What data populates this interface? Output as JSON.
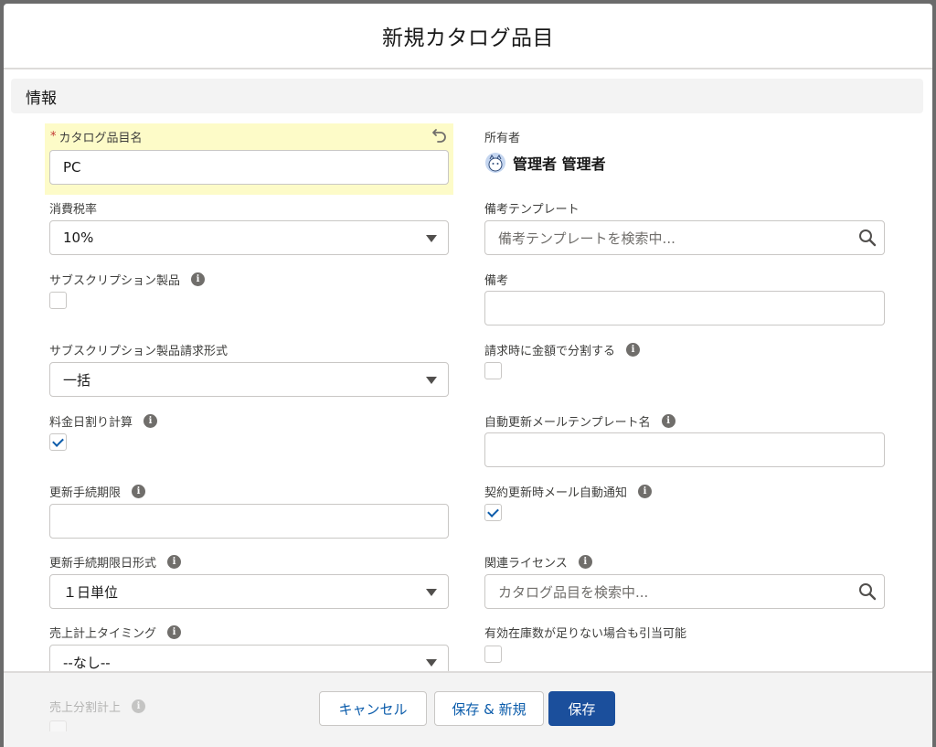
{
  "modal": {
    "title": "新規カタログ品目"
  },
  "section": {
    "title": "情報"
  },
  "fields": {
    "catalog_name": {
      "label": "カタログ品目名",
      "required_mark": "*",
      "value": "PC"
    },
    "owner": {
      "label": "所有者",
      "value": "管理者 管理者"
    },
    "tax_rate": {
      "label": "消費税率",
      "value": "10%"
    },
    "remark_template": {
      "label": "備考テンプレート",
      "placeholder": "備考テンプレートを検索中..."
    },
    "subscription_product": {
      "label": "サブスクリプション製品",
      "checked": false
    },
    "remark": {
      "label": "備考",
      "value": ""
    },
    "subscription_billing_format": {
      "label": "サブスクリプション製品請求形式",
      "value": "一括"
    },
    "split_by_amount": {
      "label": "請求時に金額で分割する",
      "checked": false
    },
    "prorated_billing": {
      "label": "料金日割り計算",
      "checked": true
    },
    "auto_renewal_mail_template": {
      "label": "自動更新メールテンプレート名",
      "value": ""
    },
    "renewal_deadline": {
      "label": "更新手続期限",
      "value": ""
    },
    "contract_renewal_mail_notify": {
      "label": "契約更新時メール自動通知",
      "checked": true
    },
    "renewal_deadline_format": {
      "label": "更新手続期限日形式",
      "value": "１日単位"
    },
    "related_license": {
      "label": "関連ライセンス",
      "placeholder": "カタログ品目を検索中..."
    },
    "sales_timing": {
      "label": "売上計上タイミング",
      "value": "--なし--"
    },
    "allocate_if_insufficient": {
      "label": "有効在庫数が足りない場合も引当可能",
      "checked": false
    },
    "split_sales": {
      "label": "売上分割計上",
      "checked": false
    }
  },
  "icons": {
    "info": "i"
  },
  "footer": {
    "cancel_label": "キャンセル",
    "save_new_label": "保存 & 新規",
    "save_label": "保存"
  },
  "colors": {
    "brand": "#1b4f9c",
    "highlight": "#fdfbc8",
    "required": "#c23934"
  }
}
